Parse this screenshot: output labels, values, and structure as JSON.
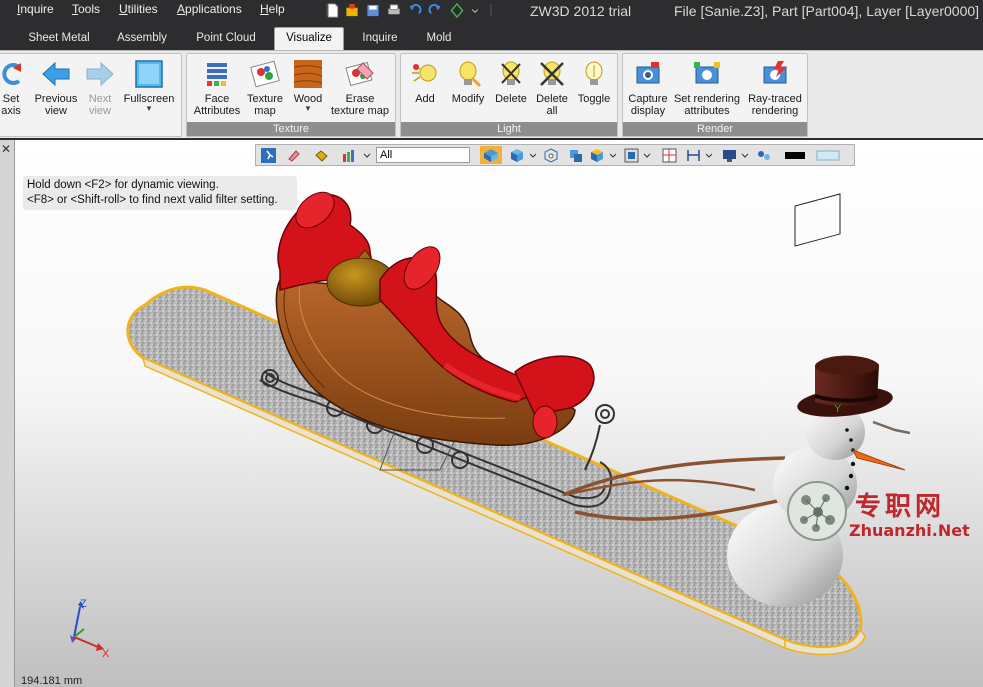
{
  "menu": [
    {
      "label": "Inquire"
    },
    {
      "label": "Tools"
    },
    {
      "label": "Utilities"
    },
    {
      "label": "Applications"
    },
    {
      "label": "Help"
    }
  ],
  "window": {
    "app_title": "ZW3D 2012 trial",
    "file_info": "File [Sanie.Z3],  Part [Part004],  Layer [Layer0000]"
  },
  "tabs": [
    {
      "label": "Sheet Metal"
    },
    {
      "label": "Assembly"
    },
    {
      "label": "Point Cloud"
    },
    {
      "label": "Visualize",
      "active": true
    },
    {
      "label": "Inquire"
    },
    {
      "label": "Mold"
    }
  ],
  "ribbon": {
    "view_group": {
      "set_axis": "Set\naxis",
      "previous_view": "Previous\nview",
      "next_view": "Next\nview",
      "fullscreen": "Fullscreen"
    },
    "texture_group": {
      "label": "Texture",
      "face_attributes": "Face\nAttributes",
      "texture_map": "Texture\nmap",
      "wood": "Wood",
      "erase_texture_map": "Erase\ntexture map"
    },
    "light_group": {
      "label": "Light",
      "add": "Add",
      "modify": "Modify",
      "delete": "Delete",
      "delete_all": "Delete\nall",
      "toggle": "Toggle"
    },
    "render_group": {
      "label": "Render",
      "capture_display": "Capture\ndisplay",
      "set_rendering_attributes": "Set rendering\nattributes",
      "ray_traced_rendering": "Ray-traced\nrendering"
    }
  },
  "viewport": {
    "filter_value": "All",
    "hint_line1": "Hold down <F2> for dynamic viewing.",
    "hint_line2": "<F8> or <Shift-roll> to find next valid filter setting.",
    "coords": "194.181 mm",
    "axis_x": "X",
    "axis_y": "Y",
    "axis_z": "Z"
  },
  "watermark": {
    "cn": "专职网",
    "url": "Zhuanzhi.Net"
  },
  "colors": {
    "titlebar_bg": "#2d2d30",
    "ribbon_bg": "#f3f3f3",
    "group_label_bg": "#8e8e8e",
    "sled_red": "#d4121a",
    "board_orange": "#f2b21c",
    "watermark_red": "#c0272d"
  }
}
